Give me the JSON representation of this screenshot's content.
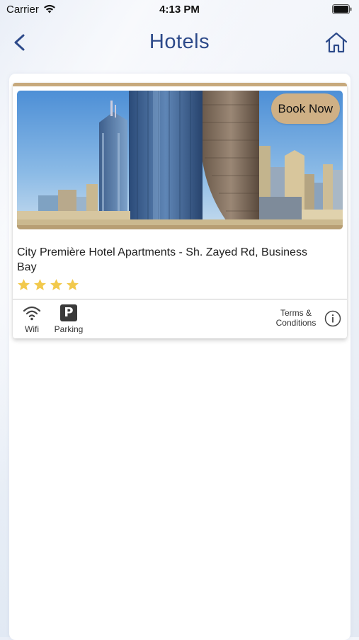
{
  "status_bar": {
    "carrier": "Carrier",
    "time": "4:13 PM"
  },
  "nav": {
    "title": "Hotels",
    "back_icon": "chevron-left-icon",
    "home_icon": "home-icon",
    "accent_color": "#2d4a8a"
  },
  "hotels": [
    {
      "name": "City Première Hotel Apartments - Sh. Zayed Rd, Business Bay",
      "book_label": "Book Now",
      "rating": 4,
      "rating_max": 4,
      "amenities": [
        {
          "label": "Wifi",
          "icon": "wifi-icon"
        },
        {
          "label": "Parking",
          "icon": "parking-icon"
        }
      ],
      "terms_label": "Terms & Conditions",
      "info_icon": "info-icon"
    }
  ],
  "colors": {
    "card_accent": "#c7a97c",
    "book_button": "#cfb085",
    "star": "#f2c94c"
  }
}
